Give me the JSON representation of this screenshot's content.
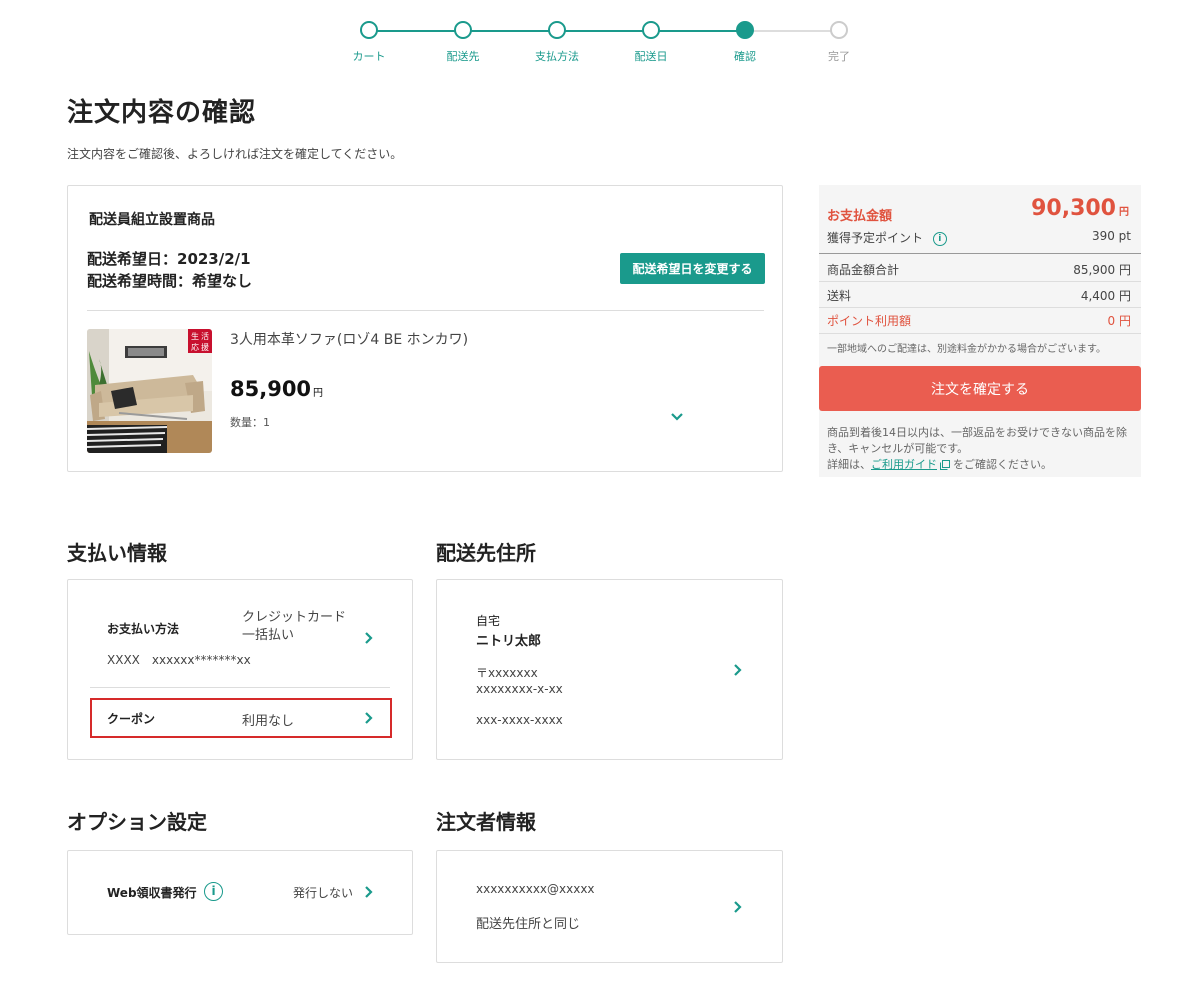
{
  "stepper": {
    "steps": [
      {
        "label": "カート",
        "state": "done"
      },
      {
        "label": "配送先",
        "state": "done"
      },
      {
        "label": "支払方法",
        "state": "done"
      },
      {
        "label": "配送日",
        "state": "done"
      },
      {
        "label": "確認",
        "state": "current"
      },
      {
        "label": "完了",
        "state": "todo"
      }
    ]
  },
  "page": {
    "title": "注文内容の確認",
    "description": "注文内容をご確認後、よろしければ注文を確定してください。"
  },
  "order": {
    "heading": "配送員組立設置商品",
    "delivery_date": "配送希望日：2023/2/1",
    "delivery_time": "配送希望時間：希望なし",
    "change_date_button": "配送希望日を変更する",
    "product": {
      "name": "3人用本革ソファ(ロゾ4 BE ホンカワ)",
      "price": "85,900",
      "price_unit": "円",
      "quantity": "数量：1",
      "badge": [
        "生",
        "活",
        "応",
        "援"
      ]
    }
  },
  "summary": {
    "pay_label": "お支払金額",
    "pay_value": "90,300",
    "pay_unit": "円",
    "points_label": "獲得予定ポイント",
    "points_value": "390 pt",
    "subtotal_label": "商品金額合計",
    "subtotal_value": "85,900 円",
    "shipping_label": "送料",
    "shipping_value": "4,400 円",
    "point_use_label": "ポイント利用額",
    "point_use_value": "0 円",
    "regional_note": "一部地域へのご配達は、別途料金がかかる場合がございます。",
    "confirm_button": "注文を確定する",
    "return_note": "商品到着後14日以内は、一部返品をお受けできない商品を除き、キャンセルが可能です。",
    "guide_prefix": "詳細は、",
    "guide_link": "ご利用ガイド",
    "guide_suffix": "をご確認ください。"
  },
  "payment": {
    "title": "支払い情報",
    "method_label": "お支払い方法",
    "method_value_1": "クレジットカード",
    "method_value_2": "一括払い",
    "card_number": "XXXX　xxxxxx*******xx",
    "coupon_label": "クーポン",
    "coupon_value": "利用なし"
  },
  "address": {
    "title": "配送先住所",
    "type": "自宅",
    "name": "ニトリ太郎",
    "postal": "〒xxxxxxx",
    "line": "xxxxxxxx-x-xx",
    "phone": "xxx-xxxx-xxxx"
  },
  "options": {
    "title": "オプション設定",
    "receipt_label": "Web領収書発行",
    "receipt_value": "発行しない"
  },
  "orderer": {
    "title": "注文者情報",
    "email": "xxxxxxxxxx@xxxxx",
    "same_as": "配送先住所と同じ"
  },
  "colors": {
    "accent": "#1a9a8c",
    "alert": "#e0533f",
    "confirm": "#ea5d50",
    "highlight_border": "#d62a2a"
  }
}
